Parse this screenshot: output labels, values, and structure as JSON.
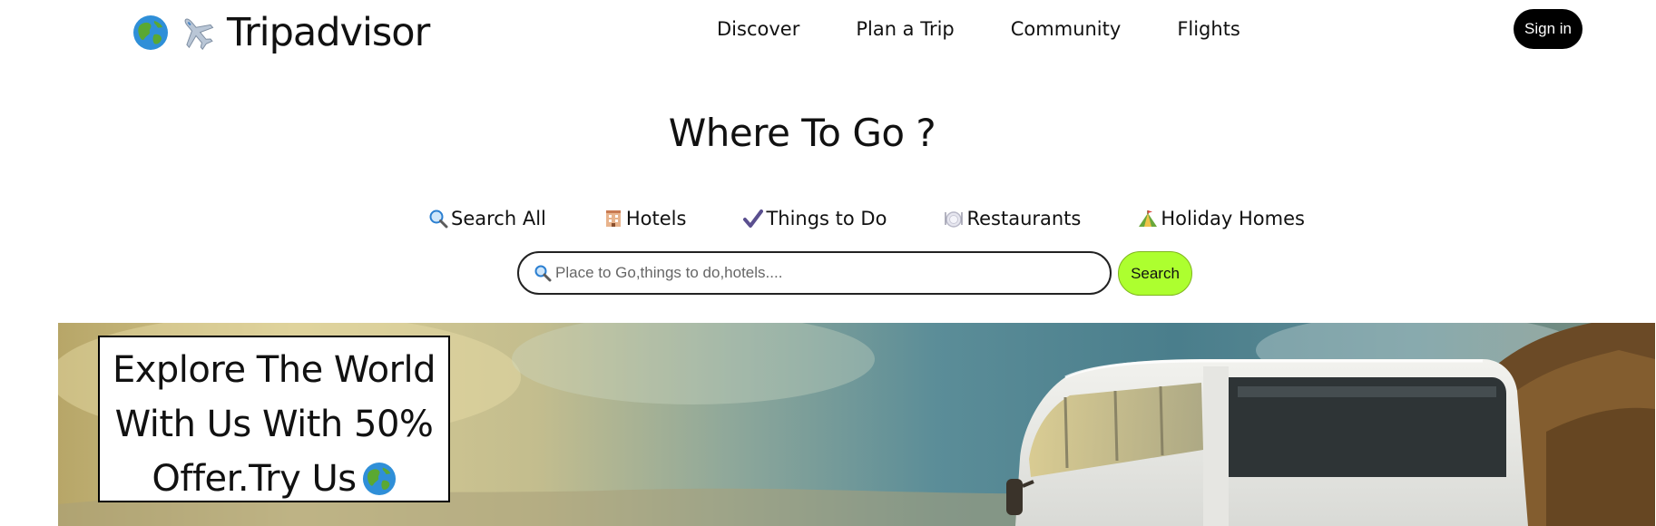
{
  "brand": {
    "name": "Tripadvisor",
    "icons": [
      "globe-icon",
      "airplane-icon"
    ]
  },
  "nav": {
    "items": [
      {
        "label": "Discover"
      },
      {
        "label": "Plan a Trip"
      },
      {
        "label": "Community"
      },
      {
        "label": "Flights"
      }
    ],
    "signin_label": "Sign in"
  },
  "hero": {
    "heading": "Where To Go ?"
  },
  "tabs": [
    {
      "label": "Search All",
      "icon": "magnifier-icon"
    },
    {
      "label": "Hotels",
      "icon": "hotel-icon"
    },
    {
      "label": "Things to Do",
      "icon": "checkmark-icon"
    },
    {
      "label": "Restaurants",
      "icon": "plate-icon"
    },
    {
      "label": "Holiday Homes",
      "icon": "tent-icon"
    }
  ],
  "search": {
    "placeholder": "Place to Go,things to do,hotels....",
    "button_label": "Search"
  },
  "banner": {
    "offer_lines": [
      "Explore The World",
      "With Us With 50%",
      "Offer.Try Us"
    ]
  },
  "colors": {
    "search_button": "#adff2f",
    "signin_bg": "#000000"
  }
}
